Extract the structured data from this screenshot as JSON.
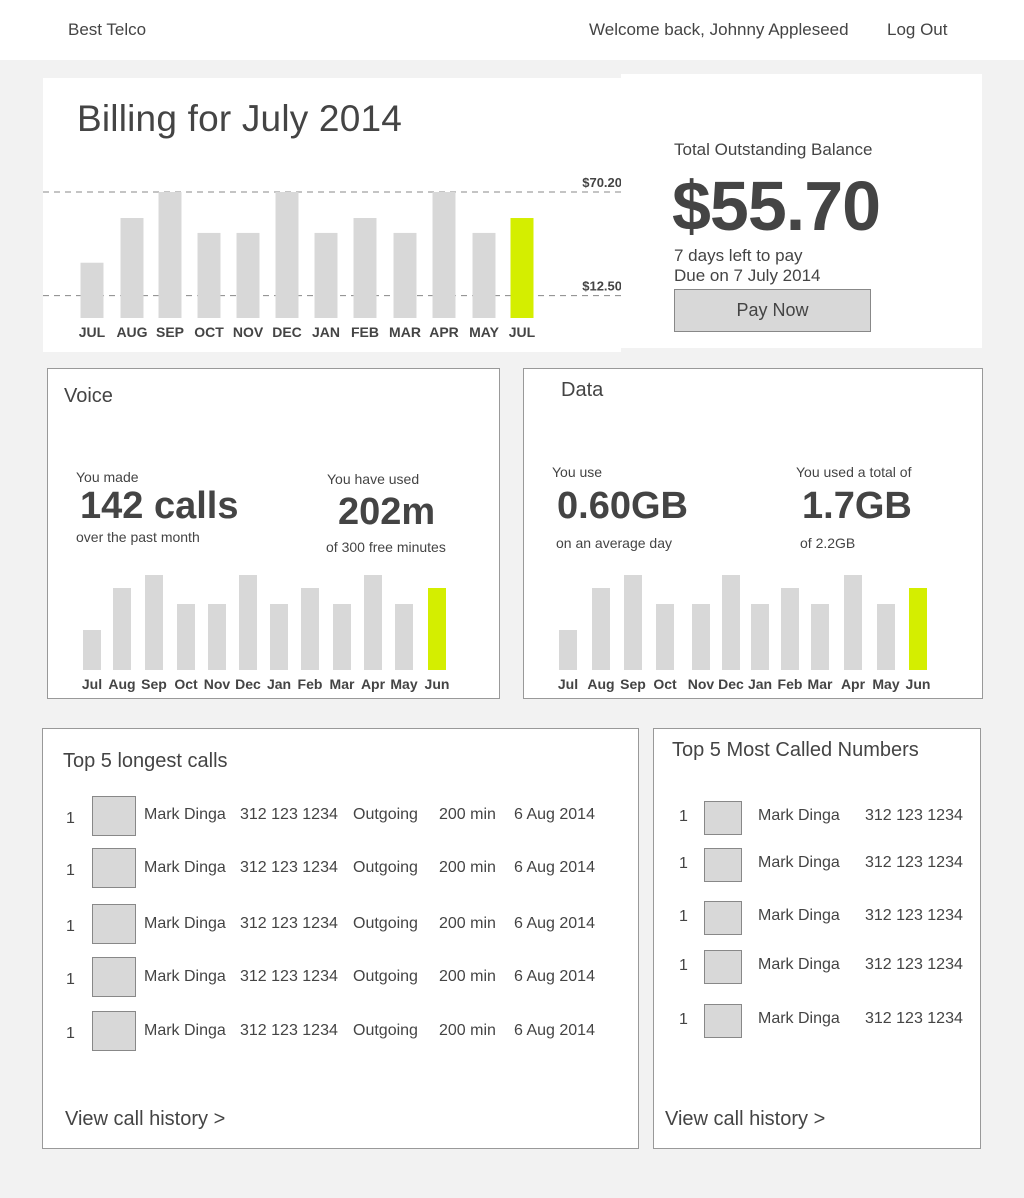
{
  "header": {
    "brand": "Best Telco",
    "welcome": "Welcome back, Johnny Appleseed",
    "logout": "Log Out"
  },
  "billing": {
    "title": "Billing for July 2014",
    "chart_data": {
      "type": "bar",
      "categories": [
        "JUL",
        "AUG",
        "SEP",
        "OCT",
        "NOV",
        "DEC",
        "JAN",
        "FEB",
        "MAR",
        "APR",
        "MAY",
        "JUL"
      ],
      "values": [
        30.8,
        55.7,
        70.2,
        47.4,
        47.4,
        70.2,
        47.4,
        55.7,
        47.4,
        70.2,
        47.4,
        55.7
      ],
      "reference_lines": [
        {
          "label": "$70.20",
          "value": 70.2
        },
        {
          "label": "$12.50",
          "value": 12.5
        }
      ],
      "highlight_index": 11,
      "colors": {
        "bar": "#d8d8d8",
        "highlight": "#d4ee00",
        "refline": "#888888"
      }
    }
  },
  "balance": {
    "label": "Total Outstanding Balance",
    "amount": "$55.70",
    "days_left": "7 days left to pay",
    "due": "Due on 7 July 2014",
    "pay_button": "Pay Now"
  },
  "voice": {
    "title": "Voice",
    "stat1": {
      "pre": "You made",
      "big": "142 calls",
      "post": "over the past month"
    },
    "stat2": {
      "pre": "You have used",
      "big": "202m",
      "post": "of 300 free minutes"
    },
    "chart_data": {
      "type": "bar",
      "categories": [
        "Jul",
        "Aug",
        "Sep",
        "Oct",
        "Nov",
        "Dec",
        "Jan",
        "Feb",
        "Mar",
        "Apr",
        "May",
        "Jun"
      ],
      "values": [
        40,
        82,
        95,
        66,
        66,
        95,
        66,
        82,
        66,
        95,
        66,
        82
      ],
      "highlight_index": 11,
      "colors": {
        "bar": "#d8d8d8",
        "highlight": "#d4ee00"
      }
    }
  },
  "data_panel": {
    "title": "Data",
    "stat1": {
      "pre": "You use",
      "big": "0.60GB",
      "post": "on an average day"
    },
    "stat2": {
      "pre": "You used a total of",
      "big": "1.7GB",
      "post": "of 2.2GB"
    },
    "chart_data": {
      "type": "bar",
      "categories": [
        "Jul",
        "Aug",
        "Sep",
        "Oct",
        "Nov",
        "Dec",
        "Jan",
        "Feb",
        "Mar",
        "Apr",
        "May",
        "Jun"
      ],
      "values": [
        40,
        82,
        95,
        66,
        66,
        95,
        66,
        82,
        66,
        95,
        66,
        82
      ],
      "highlight_index": 11,
      "colors": {
        "bar": "#d8d8d8",
        "highlight": "#d4ee00"
      }
    }
  },
  "longest_calls": {
    "title": "Top 5 longest calls",
    "rows": [
      {
        "rank": "1",
        "name": "Mark Dinga",
        "number": "312 123 1234",
        "direction": "Outgoing",
        "duration": "200 min",
        "date": "6 Aug 2014"
      },
      {
        "rank": "1",
        "name": "Mark Dinga",
        "number": "312 123 1234",
        "direction": "Outgoing",
        "duration": "200 min",
        "date": "6 Aug 2014"
      },
      {
        "rank": "1",
        "name": "Mark Dinga",
        "number": "312 123 1234",
        "direction": "Outgoing",
        "duration": "200 min",
        "date": "6 Aug 2014"
      },
      {
        "rank": "1",
        "name": "Mark Dinga",
        "number": "312 123 1234",
        "direction": "Outgoing",
        "duration": "200 min",
        "date": "6 Aug 2014"
      },
      {
        "rank": "1",
        "name": "Mark Dinga",
        "number": "312 123 1234",
        "direction": "Outgoing",
        "duration": "200 min",
        "date": "6 Aug 2014"
      }
    ],
    "link": "View call history >"
  },
  "most_called": {
    "title": "Top 5 Most Called Numbers",
    "rows": [
      {
        "rank": "1",
        "name": "Mark Dinga",
        "number": "312 123 1234"
      },
      {
        "rank": "1",
        "name": "Mark Dinga",
        "number": "312 123 1234"
      },
      {
        "rank": "1",
        "name": "Mark Dinga",
        "number": "312 123 1234"
      },
      {
        "rank": "1",
        "name": "Mark Dinga",
        "number": "312 123 1234"
      },
      {
        "rank": "1",
        "name": "Mark Dinga",
        "number": "312 123 1234"
      }
    ],
    "link": "View call history >"
  }
}
